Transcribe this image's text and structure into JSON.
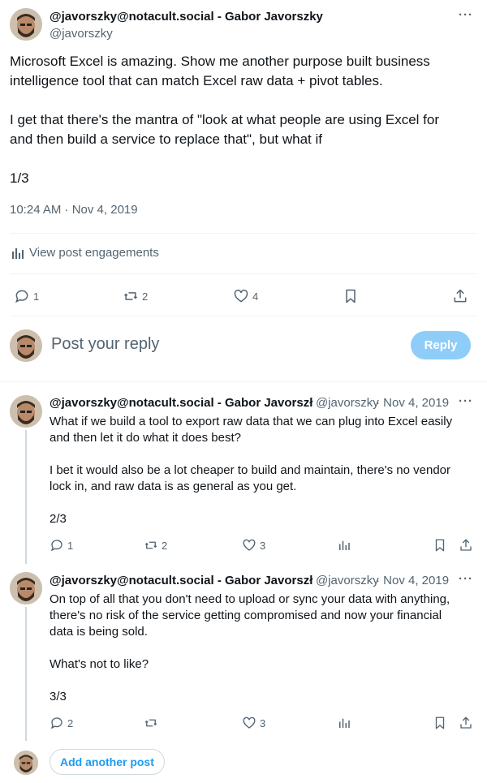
{
  "main_post": {
    "author_name": "@javorszky@notacult.social - Gabor Javorszky",
    "handle": "@javorszky",
    "text_lines": [
      "Microsoft Excel is amazing. Show me another purpose built business",
      "intelligence tool that can match Excel raw data + pivot tables.",
      "",
      "I get that there's the mantra of \"look at what people are using Excel for",
      "and then build a service to replace that\", but what if",
      "",
      "1/3"
    ],
    "timestamp": "10:24 AM · Nov 4, 2019",
    "engagements_label": "View post engagements",
    "replies": "1",
    "reposts": "2",
    "likes": "4"
  },
  "composer": {
    "placeholder": "Post your reply",
    "reply_label": "Reply"
  },
  "thread": [
    {
      "author_name": "@javorszky@notacult.social - Gabor Javorszł",
      "handle": "@javorszky",
      "date": "· Nov 4, 2019",
      "text_lines": [
        "What if we build a tool to export raw data that we can plug into Excel easily",
        "and then let it do what it does best?",
        "",
        "I bet it would also be a lot cheaper to build and maintain, there's no vendor",
        "lock in, and raw data is as general as you get.",
        "",
        "2/3"
      ],
      "replies": "1",
      "reposts": "2",
      "likes": "3"
    },
    {
      "author_name": "@javorszky@notacult.social - Gabor Javorszł",
      "handle": "@javorszky",
      "date": "· Nov 4, 2019",
      "text_lines": [
        "On top of all that you don't need to upload or sync your data with anything,",
        "there's no risk of the service getting compromised and now your financial",
        "data is being sold.",
        "",
        "What's not to like?",
        "",
        "3/3"
      ],
      "replies": "2",
      "reposts": "",
      "likes": "3"
    }
  ],
  "add_another_label": "Add another post",
  "colors": {
    "accent": "#1d9bf0",
    "reply_button": "#8ecdf8",
    "muted_text": "#536471",
    "divider": "#eff3f4"
  }
}
